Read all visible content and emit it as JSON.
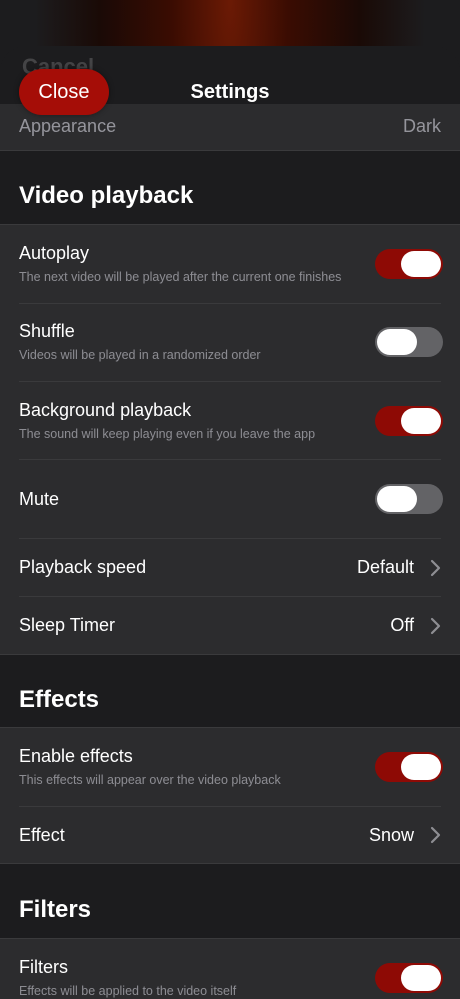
{
  "header": {
    "behind_label": "Cancel",
    "close_label": "Close",
    "title": "Settings"
  },
  "appearance": {
    "label": "Appearance",
    "value": "Dark"
  },
  "video_playback": {
    "title": "Video playback",
    "autoplay": {
      "title": "Autoplay",
      "subtitle": "The next video will be played after the current one finishes",
      "on": true
    },
    "shuffle": {
      "title": "Shuffle",
      "subtitle": "Videos will be played in a randomized order",
      "on": false
    },
    "background": {
      "title": "Background playback",
      "subtitle": "The sound will keep playing even if you leave the app",
      "on": true
    },
    "mute": {
      "title": "Mute",
      "on": false
    },
    "speed": {
      "title": "Playback speed",
      "value": "Default"
    },
    "sleep": {
      "title": "Sleep Timer",
      "value": "Off"
    }
  },
  "effects": {
    "title": "Effects",
    "enable": {
      "title": "Enable effects",
      "subtitle": "This effects will appear over the video playback",
      "on": true
    },
    "effect": {
      "title": "Effect",
      "value": "Snow"
    }
  },
  "filters": {
    "title": "Filters",
    "filters": {
      "title": "Filters",
      "subtitle": "Effects will be applied to the video itself",
      "on": true
    }
  },
  "colors": {
    "accent": "#a50d07",
    "toggle_on": "#8e0a05",
    "toggle_off": "#636366",
    "background": "#1c1c1e",
    "cell": "#2c2c2e"
  }
}
